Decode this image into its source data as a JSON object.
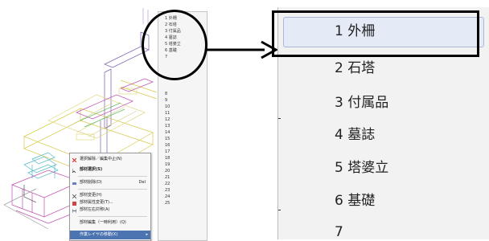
{
  "context_menu": {
    "items": [
      {
        "label": "選択解除／編集中止(N)",
        "shortcut": "",
        "icon": "red-x-icon"
      },
      {
        "label": "部材選択(S)",
        "shortcut": "",
        "icon": "pointer-icon"
      },
      {
        "label": "部材削除(D)",
        "shortcut": "Del",
        "icon": "eraser-icon"
      },
      {
        "label": "部材変更(H)",
        "shortcut": "",
        "icon": "scissors-icon"
      },
      {
        "label": "部材属性変更(T)...",
        "shortcut": "",
        "icon": "attribute-icon"
      },
      {
        "label": "部材左右対称(A)",
        "shortcut": "",
        "icon": "mirror-icon"
      },
      {
        "label": "部材編集（一時利用）(Q)",
        "shortcut": "",
        "icon": ""
      },
      {
        "label": "作業レイヤの移動(X)",
        "shortcut": "",
        "icon": "submenu-arrow-icon"
      }
    ]
  },
  "small_list": {
    "items": [
      "1 外柵",
      "2 石塔",
      "3 付属品",
      "4 墓誌",
      "5 塔婆立",
      "6 基礎",
      "7",
      "8",
      "9",
      "10",
      "11",
      "12",
      "13",
      "14",
      "15",
      "16",
      "17",
      "18",
      "19",
      "20",
      "21",
      "22",
      "23",
      "24",
      "25"
    ]
  },
  "big_list": {
    "items": [
      "1 外柵",
      "2 石塔",
      "3 付属品",
      "4 墓誌",
      "5 塔婆立",
      "6 基礎",
      "7"
    ],
    "highlighted_index": 0
  },
  "colors": {
    "wire_yellow": "#d6c94a",
    "wire_purple": "#7b5fb0",
    "wire_cyan": "#4fb8c8",
    "wire_magenta": "#c04fb0",
    "menu_highlight": "#4c74b0",
    "big_highlight": "#e4eaf6"
  }
}
